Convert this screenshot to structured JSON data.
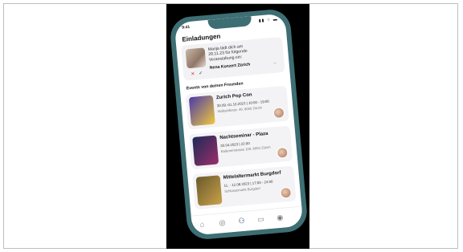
{
  "status": {
    "time": "9:41",
    "icons": "▮▮ ⌔ ▬"
  },
  "screen_title": "Einladungen",
  "invitation": {
    "text": "Marija lädt dich am 28.11.23 für folgende Veranstaltung ein:",
    "event": "Nena Konzert Zürich",
    "decline_icon": "x-icon",
    "accept_icon": "check-icon"
  },
  "section_title": "Events von deinen Freunden",
  "events": [
    {
      "title": "Zurich Pop Con",
      "date": "30.09.-01.10.2023 | 10:00 - 19:00",
      "location": "Wallisellenstr. 49, 8050 Zürich",
      "colors": [
        "#4a3aa8",
        "#f0c93e"
      ]
    },
    {
      "title": "Nachtseminar - Plaza",
      "date": "20.04.2023 | 22:00",
      "location": "Badenerstrasse 109, 8004 Zürich",
      "colors": [
        "#1c2a56",
        "#9b2f6b"
      ]
    },
    {
      "title": "Mittelaltermarkt Burgdorf",
      "date": "11. - 12.08.2023 | 17:00 - 24:00",
      "location": "Schlossemarkt Burgdorf",
      "colors": [
        "#6b5a2a",
        "#c9a14b"
      ]
    }
  ],
  "tabs": [
    "home-icon",
    "compass-icon",
    "friends-icon",
    "ticket-icon",
    "profile-icon"
  ]
}
